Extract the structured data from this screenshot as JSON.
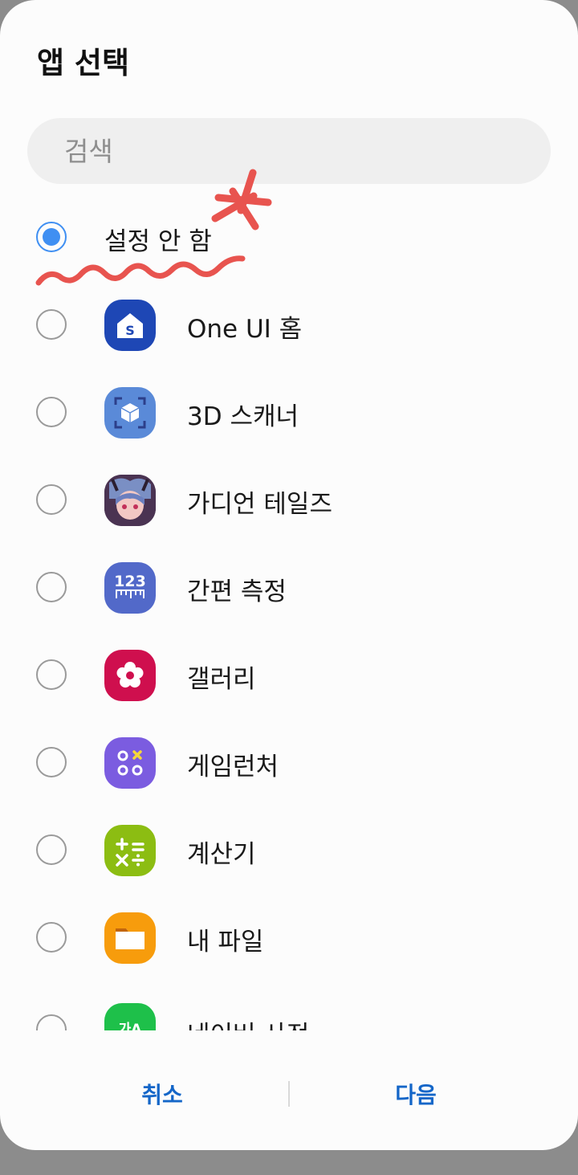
{
  "dialog": {
    "title": "앱 선택",
    "search_placeholder": "검색",
    "apps": [
      {
        "label": "설정 안 함",
        "checked": true,
        "icon": "none"
      },
      {
        "label": "One UI 홈",
        "checked": false,
        "icon": "one-ui-home-icon"
      },
      {
        "label": "3D 스캐너",
        "checked": false,
        "icon": "3d-scanner-icon"
      },
      {
        "label": "가디언 테일즈",
        "checked": false,
        "icon": "guardian-tales-icon"
      },
      {
        "label": "간편 측정",
        "checked": false,
        "icon": "quick-measure-icon",
        "icon_text": "123"
      },
      {
        "label": "갤러리",
        "checked": false,
        "icon": "gallery-icon"
      },
      {
        "label": "게임런처",
        "checked": false,
        "icon": "game-launcher-icon"
      },
      {
        "label": "계산기",
        "checked": false,
        "icon": "calculator-icon"
      },
      {
        "label": "내 파일",
        "checked": false,
        "icon": "my-files-icon"
      },
      {
        "label": "네이버 사전",
        "checked": false,
        "icon": "naver-dictionary-icon",
        "icon_text": "가A"
      }
    ],
    "cancel_label": "취소",
    "next_label": "다음"
  },
  "colors": {
    "accent": "#3f8ff2",
    "button_text": "#1466c8",
    "annotation": "#e8544f"
  }
}
